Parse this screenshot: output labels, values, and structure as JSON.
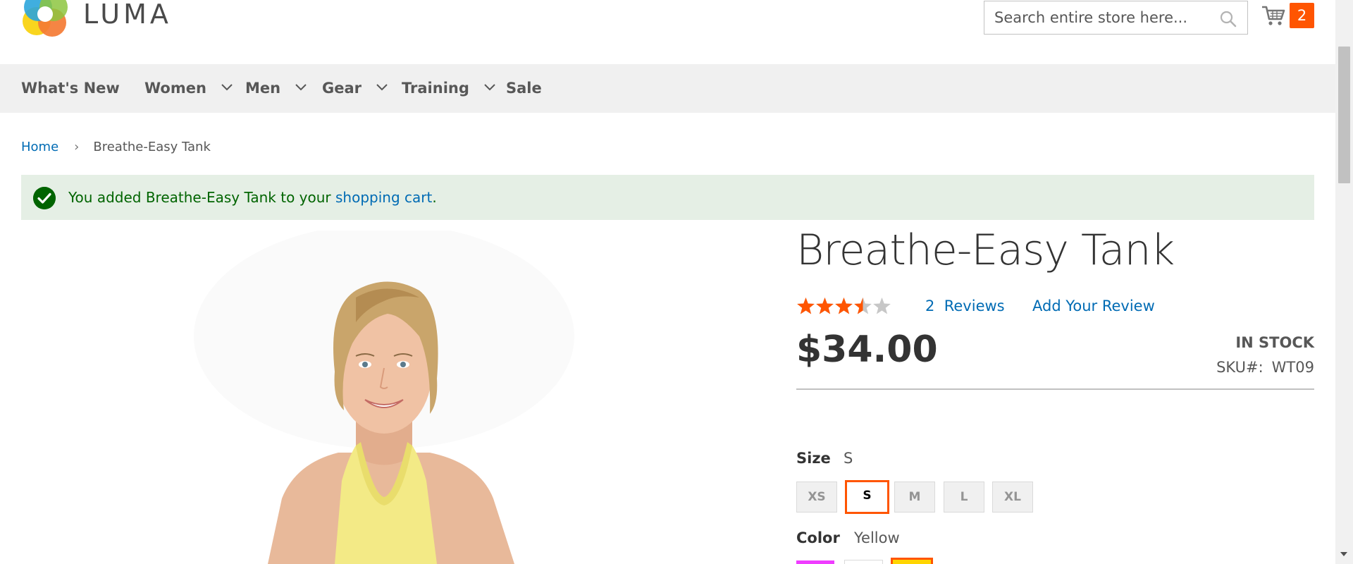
{
  "header": {
    "logo_text": "LUMA",
    "search_placeholder": "Search entire store here...",
    "cart_count": "2"
  },
  "nav": {
    "items": [
      {
        "label": "What's New",
        "has_dropdown": false
      },
      {
        "label": "Women",
        "has_dropdown": true
      },
      {
        "label": "Men",
        "has_dropdown": true
      },
      {
        "label": "Gear",
        "has_dropdown": true
      },
      {
        "label": "Training",
        "has_dropdown": true
      },
      {
        "label": "Sale",
        "has_dropdown": false
      }
    ]
  },
  "breadcrumb": {
    "home": "Home",
    "separator": "›",
    "current": "Breathe-Easy Tank"
  },
  "message": {
    "prefix": "You added Breathe-Easy Tank to your ",
    "link": "shopping cart",
    "suffix": "."
  },
  "product": {
    "title": "Breathe-Easy Tank",
    "rating_percent": 70,
    "reviews_count": "2",
    "reviews_label": "Reviews",
    "add_review": "Add Your Review",
    "price": "$34.00",
    "stock": "IN STOCK",
    "sku_label": "SKU#:",
    "sku": "WT09",
    "size_label": "Size",
    "size_selected": "S",
    "sizes": [
      "XS",
      "S",
      "M",
      "L",
      "XL"
    ],
    "color_label": "Color",
    "color_selected": "Yellow",
    "colors": [
      {
        "name": "Purple",
        "hex": "#ef3dff"
      },
      {
        "name": "White",
        "hex": "#ffffff"
      },
      {
        "name": "Yellow",
        "hex": "#ffd500"
      }
    ]
  },
  "colors": {
    "accent": "#ff5501",
    "link": "#006bb4",
    "success_bg": "#e5efe5",
    "success_text": "#006400",
    "nav_bg": "#f0f0f0"
  }
}
